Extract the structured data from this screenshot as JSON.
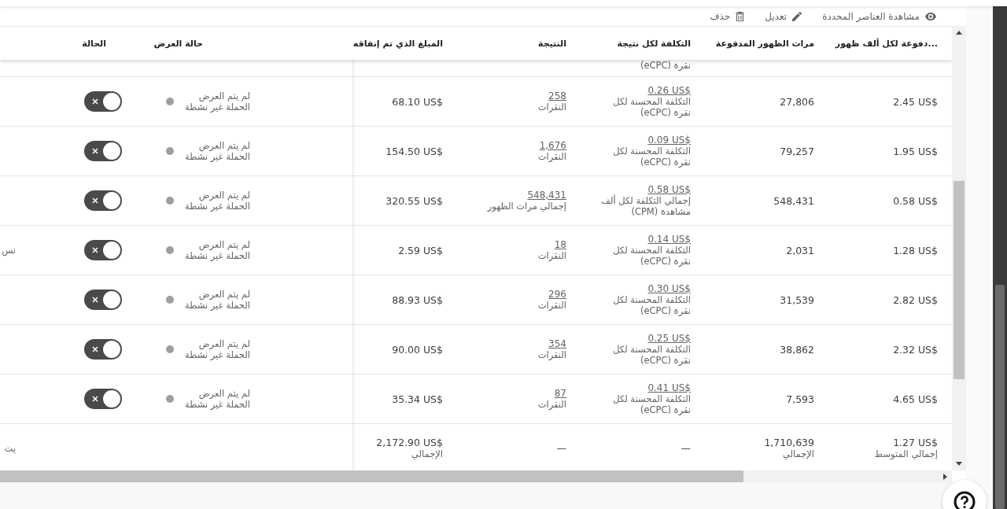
{
  "toolbar": {
    "actions": [
      {
        "kind": "view",
        "label": "مشاهدة العناصر المحددة"
      },
      {
        "kind": "edit",
        "label": "تعديل"
      },
      {
        "kind": "delete",
        "label": "حذف"
      }
    ]
  },
  "table": {
    "columns": [
      "...دفوعة لكل ألف ظهور",
      "مرات الظهور المدفوعة",
      "التكلفة لكل نتيجة",
      "النتيجة",
      "المبلغ الذي تم إنفاقه",
      "حالة العرض",
      "الحالة"
    ],
    "partial_row": {
      "cost_label": "نقرة (eCPC)"
    },
    "rows": [
      {
        "cpm": "2.45 US$",
        "impressions": "27,806",
        "cost": "0.26 US$",
        "cost_label": "التكلفة المحسنة لكل نقرة (eCPC)",
        "result": "258",
        "result_label": "النقرات",
        "spent": "68.10 US$",
        "delivery": "لم يتم العرض",
        "delivery_detail": "الحملة غير نشطة",
        "on": false
      },
      {
        "cpm": "1.95 US$",
        "impressions": "79,257",
        "cost": "0.09 US$",
        "cost_label": "التكلفة المحسنة لكل نقرة (eCPC)",
        "result": "1,676",
        "result_label": "النقرات",
        "spent": "154.50 US$",
        "delivery": "لم يتم العرض",
        "delivery_detail": "الحملة غير نشطة",
        "on": false
      },
      {
        "cpm": "0.58 US$",
        "impressions": "548,431",
        "cost": "0.58 US$",
        "cost_label": "إجمالي التكلفة لكل ألف مشاهدة (CPM)",
        "result": "548,431",
        "result_label": "إجمالي مرات الظهور",
        "spent": "320.55 US$",
        "delivery": "لم يتم العرض",
        "delivery_detail": "الحملة غير نشطة",
        "on": false
      },
      {
        "cpm": "1.28 US$",
        "impressions": "2,031",
        "cost": "0.14 US$",
        "cost_label": "التكلفة المحسنة لكل نقرة (eCPC)",
        "result": "18",
        "result_label": "النقرات",
        "spent": "2.59 US$",
        "delivery": "لم يتم العرض",
        "delivery_detail": "الحملة غير نشطة",
        "on": false,
        "column_8": "نس"
      },
      {
        "cpm": "2.82 US$",
        "impressions": "31,539",
        "cost": "0.30 US$",
        "cost_label": "التكلفة المحسنة لكل نقرة (eCPC)",
        "result": "296",
        "result_label": "النقرات",
        "spent": "88.93 US$",
        "delivery": "لم يتم العرض",
        "delivery_detail": "الحملة غير نشطة",
        "on": false
      },
      {
        "cpm": "2.32 US$",
        "impressions": "38,862",
        "cost": "0.25 US$",
        "cost_label": "التكلفة المحسنة لكل نقرة (eCPC)",
        "result": "354",
        "result_label": "النقرات",
        "spent": "90.00 US$",
        "delivery": "لم يتم العرض",
        "delivery_detail": "الحملة غير نشطة",
        "on": false
      },
      {
        "cpm": "4.65 US$",
        "impressions": "7,593",
        "cost": "0.41 US$",
        "cost_label": "التكلفة المحسنة لكل نقرة (eCPC)",
        "result": "87",
        "result_label": "النقرات",
        "spent": "35.34 US$",
        "delivery": "لم يتم العرض",
        "delivery_detail": "الحملة غير نشطة",
        "on": false
      }
    ],
    "totals": {
      "cpm": "1.27 US$",
      "cpm_label": "إجمالي المتوسط",
      "impressions": "1,710,639",
      "impressions_label": "الإجمالي",
      "cost": "—",
      "result": "—",
      "spent": "2,172.90 US$",
      "spent_label": "الإجمالي",
      "column_8": "يت"
    }
  }
}
